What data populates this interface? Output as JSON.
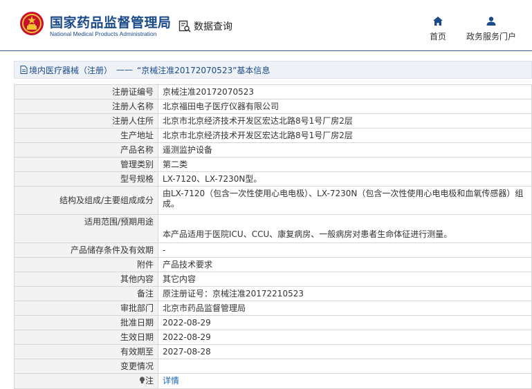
{
  "header": {
    "site_name": "国家药品监督管理局",
    "site_name_en": "National Medical Products Administration",
    "data_query": "数据查询",
    "home": "首页",
    "portal": "政务服务门户"
  },
  "breadcrumb": {
    "category": "境内医疗器械（注册）",
    "separator": "——",
    "current": "“京械注准20172070523”基本信息"
  },
  "rows": [
    {
      "label": "注册证编号",
      "value": "京械注准20172070523"
    },
    {
      "label": "注册人名称",
      "value": "北京福田电子医疗仪器有限公司"
    },
    {
      "label": "注册人住所",
      "value": "北京市北京经济技术开发区宏达北路8号1号厂房2层"
    },
    {
      "label": "生产地址",
      "value": "北京市北京经济技术开发区宏达北路8号1号厂房2层"
    },
    {
      "label": "产品名称",
      "value": "遥测监护设备"
    },
    {
      "label": "管理类别",
      "value": "第二类"
    },
    {
      "label": "型号规格",
      "value": "LX-7120、LX-7230N型。"
    },
    {
      "label": "结构及组成/主要组成成分",
      "value": "由LX-7120（包含一次性使用心电电极）、LX-7230N（包含一次性使用心电电极和血氧传感器）组成。"
    },
    {
      "label": "适用范围/预期用途",
      "value": "本产品适用于医院ICU、CCU、康复病房、一般病房对患者生命体征进行测量。"
    },
    {
      "label": "产品储存条件及有效期",
      "value": "-"
    },
    {
      "label": "附件",
      "value": "产品技术要求"
    },
    {
      "label": "其他内容",
      "value": "其它内容"
    },
    {
      "label": "备注",
      "value": "原注册证号：京械注准20172210523"
    },
    {
      "label": "审批部门",
      "value": "北京市药品监督管理局"
    },
    {
      "label": "批准日期",
      "value": "2022-08-29"
    },
    {
      "label": "生效日期",
      "value": "2022-08-29"
    },
    {
      "label": "有效期至",
      "value": "2027-08-28"
    },
    {
      "label": "变更情况",
      "value": ""
    },
    {
      "label": "注",
      "value": "详情"
    }
  ],
  "colors": {
    "brand": "#1a4a8a",
    "link": "#1a6ab8",
    "label_bg": "#f3f3f3",
    "border": "#d6d6d6"
  },
  "icons": {
    "logo": "national-emblem-icon",
    "data_query": "search-list-icon",
    "home": "home-icon",
    "portal": "user-icon",
    "breadcrumb": "document-icon",
    "note": "lightbulb-icon"
  }
}
